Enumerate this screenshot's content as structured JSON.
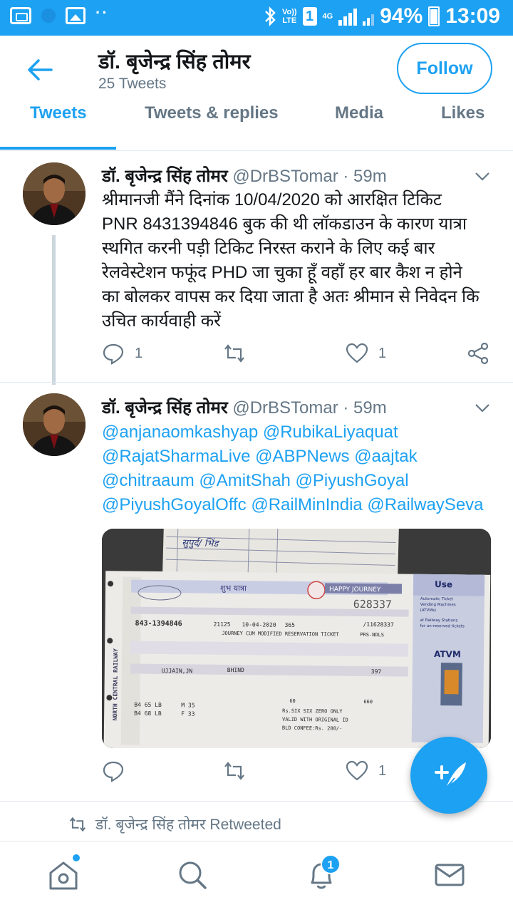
{
  "status_bar": {
    "volte_label_top": "Vo))",
    "volte_label_bottom": "LTE",
    "sim_label": "1",
    "network_label": "4G",
    "battery_percent": "94%",
    "time": "13:09"
  },
  "header": {
    "profile_name": "डॉ. बृजेन्द्र सिंह तोमर",
    "tweet_count": "25 Tweets",
    "follow_label": "Follow"
  },
  "tabs": [
    {
      "label": "Tweets",
      "active": true
    },
    {
      "label": "Tweets & replies",
      "active": false
    },
    {
      "label": "Media",
      "active": false
    },
    {
      "label": "Likes",
      "active": false
    }
  ],
  "tweets": [
    {
      "name": "डॉ. बृजेन्द्र सिंह तोमर",
      "handle": "@DrBSTomar",
      "time": " · 59m",
      "body_lines": [
        "श्रीमानजी मैंने दिनांक 10/04/2020 को आरक्षित टिकिट",
        "PNR 8431394846 बुक की थी लॉकडाउन के कारण यात्रा",
        "स्थगित करनी पड़ी टिकिट निरस्त कराने के लिए कई बार",
        "रेलवेस्टेशन फफूंद PHD जा चुका हूँ वहाँ हर बार कैश न होने",
        "का बोलकर वापस कर दिया जाता है अतः श्रीमान से निवेदन कि",
        "उचित कार्यवाही करें"
      ],
      "reply_count": "1",
      "like_count": "1"
    },
    {
      "name": "डॉ. बृजेन्द्र सिंह तोमर",
      "handle": "@DrBSTomar",
      "time": " · 59m",
      "mention_lines": [
        "@anjanaomkashyap @RubikaLiyaquat",
        "@RajatSharmaLive @ABPNews @aajtak",
        "@chitraaum @AmitShah @PiyushGoyal",
        "@PiyushGoyalOffc @RailMinIndia @RailwaySeva"
      ],
      "like_count": "1",
      "ticket": {
        "top_header": "शुभ यात्रा",
        "happy_journey": "HAPPY JOURNEY",
        "use_label": "Use",
        "atvm_lines": [
          "Automatic Ticket",
          "Vending Machines",
          "(ATVMs)",
          "at Railway Stations",
          "for un-reserved tickets"
        ],
        "atvm_label": "ATVM",
        "pnr": "843-1394846",
        "ticket_no": "628337",
        "train_no": "21125",
        "date": "10-04-2020",
        "class": "365",
        "serial": "/11628337",
        "desc": "JOURNEY CUM MODIFIED RESERVATION TICKET",
        "prs": "PRS-NDLS",
        "from": "UJJAIN,JN",
        "to": "BHIND",
        "fare": "397",
        "amount_words": "Rs.SIX SIX ZERO ONLY",
        "valid": "VALID WITH ORIGINAL ID",
        "fee": "BLD CONFEE:Rs. 200/-",
        "berth_a": "B4  65  LB",
        "berth_b": "B4  68  LB",
        "berth_c": "M 35",
        "berth_d": "F 33",
        "side": "NORTH CENTRAL RAILWAY",
        "note_handwritten": "सुपुर्द/ भिंड",
        "total": "660",
        "num_a": "60"
      }
    }
  ],
  "retweet_label": "डॉ. बृजेन्द्र सिंह तोमर Retweeted",
  "notifications_badge": "1",
  "colors": {
    "brand_blue": "#1da1f2",
    "text_primary": "#14171a",
    "text_secondary": "#657786",
    "divider": "#e1e8ed"
  }
}
